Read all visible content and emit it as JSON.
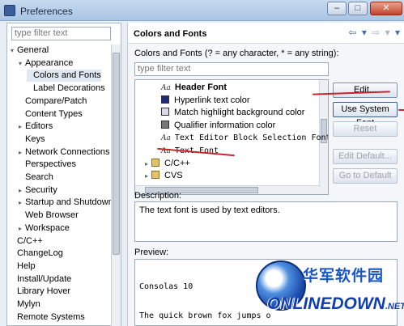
{
  "window": {
    "title": "Preferences",
    "min": "–",
    "max": "□",
    "close": "✕"
  },
  "left": {
    "filter_placeholder": "type filter text",
    "tree": [
      {
        "label": "General",
        "indent": 0,
        "twisty": "▾"
      },
      {
        "label": "Appearance",
        "indent": 1,
        "twisty": "▾"
      },
      {
        "label": "Colors and Fonts",
        "indent": 2,
        "twisty": ""
      },
      {
        "label": "Label Decorations",
        "indent": 2,
        "twisty": ""
      },
      {
        "label": "Compare/Patch",
        "indent": 1,
        "twisty": ""
      },
      {
        "label": "Content Types",
        "indent": 1,
        "twisty": ""
      },
      {
        "label": "Editors",
        "indent": 1,
        "twisty": "▸"
      },
      {
        "label": "Keys",
        "indent": 1,
        "twisty": ""
      },
      {
        "label": "Network Connections",
        "indent": 1,
        "twisty": "▸"
      },
      {
        "label": "Perspectives",
        "indent": 1,
        "twisty": ""
      },
      {
        "label": "Search",
        "indent": 1,
        "twisty": ""
      },
      {
        "label": "Security",
        "indent": 1,
        "twisty": "▸"
      },
      {
        "label": "Startup and Shutdown",
        "indent": 1,
        "twisty": "▸"
      },
      {
        "label": "Web Browser",
        "indent": 1,
        "twisty": ""
      },
      {
        "label": "Workspace",
        "indent": 1,
        "twisty": "▸"
      },
      {
        "label": "C/C++",
        "indent": 0,
        "twisty": ""
      },
      {
        "label": "ChangeLog",
        "indent": 0,
        "twisty": ""
      },
      {
        "label": "Help",
        "indent": 0,
        "twisty": ""
      },
      {
        "label": "Install/Update",
        "indent": 0,
        "twisty": ""
      },
      {
        "label": "Library Hover",
        "indent": 0,
        "twisty": ""
      },
      {
        "label": "Mylyn",
        "indent": 0,
        "twisty": ""
      },
      {
        "label": "Remote Systems",
        "indent": 0,
        "twisty": ""
      }
    ]
  },
  "right": {
    "title": "Colors and Fonts",
    "nav": {
      "back": "⇦",
      "back_menu": "▾",
      "fwd": "⇨",
      "fwd_menu": "▾",
      "menu": "▾"
    },
    "label": "Colors and Fonts (? = any character, * = any string):",
    "filter_placeholder": "type filter text",
    "list": [
      {
        "label": "Header Font",
        "icon": "font-icon",
        "bold": true,
        "mono": false
      },
      {
        "label": "Hyperlink text color",
        "icon": "color-swatch-icon",
        "color": "#1f2a78",
        "mono": false
      },
      {
        "label": "Match highlight background color",
        "icon": "color-swatch-icon",
        "color": "#dcd7ea",
        "mono": false
      },
      {
        "label": "Qualifier information color",
        "icon": "color-swatch-icon",
        "color": "#777777",
        "mono": false
      },
      {
        "label": "Text Editor Block Selection Font",
        "icon": "font-icon",
        "mono": true
      },
      {
        "label": "Text Font",
        "icon": "font-icon",
        "mono": true
      },
      {
        "label": "C/C++",
        "icon": "folder-icon",
        "mono": false
      },
      {
        "label": "CVS",
        "icon": "folder-icon",
        "mono": false
      }
    ],
    "buttons": {
      "edit": "Edit...",
      "use_system_font": "Use System Font",
      "reset": "Reset",
      "edit_default": "Edit Default...",
      "go_to_default": "Go to Default"
    },
    "description_label": "Description:",
    "description": "The text font is used by text editors.",
    "preview_label": "Preview:",
    "preview_lines": [
      "Consolas 10",
      "The quick brown fox jumps o"
    ]
  },
  "watermark": {
    "cn": "华军软件园",
    "en": "ONLINEDOWN",
    "net": ".NET"
  },
  "colors": {
    "annotation_red": "#c8262e",
    "accent": "#3b6fb0"
  }
}
